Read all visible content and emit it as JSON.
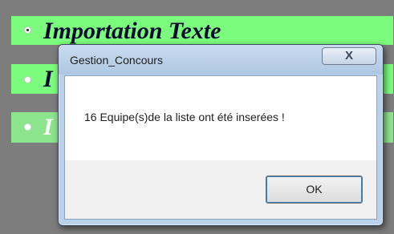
{
  "background_options": [
    {
      "label": "Importation Texte",
      "selected": true
    },
    {
      "label": "I",
      "selected": false
    },
    {
      "label": "I",
      "selected": false
    }
  ],
  "dialog": {
    "title": "Gestion_Concours",
    "close_label": "X",
    "message": "16 Equipe(s)de la liste ont été inserées !",
    "ok_label": "OK"
  },
  "colors": {
    "option_bg": "#7cfc7c",
    "dialog_frame": "#b9d1ea",
    "backdrop": "#7d7d7d"
  }
}
